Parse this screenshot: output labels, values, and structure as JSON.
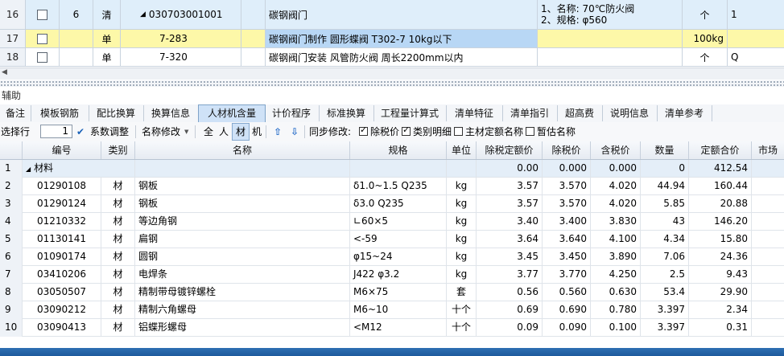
{
  "top_rows": [
    {
      "num": "16",
      "idx": "6",
      "type": "清",
      "code": "030703001001",
      "name": "碳钢阀门",
      "desc_line1": "1、名称: 70℃防火阀",
      "desc_line2": "2、规格: φ560",
      "unit": "个",
      "qty": "1"
    },
    {
      "num": "17",
      "idx": "",
      "type": "单",
      "code": "7-283",
      "name": "碳钢阀门制作 圆形蝶阀 T302-7 10kg以下",
      "desc_line1": "",
      "desc_line2": "",
      "unit": "100kg",
      "qty": ""
    },
    {
      "num": "18",
      "idx": "",
      "type": "单",
      "code": "7-320",
      "name": "碳钢阀门安装 风管防火阀 周长2200mm以内",
      "desc_line1": "",
      "desc_line2": "",
      "unit": "个",
      "qty": "Q"
    }
  ],
  "aux_label": "辅助",
  "tabs": [
    "备注",
    "模板钢筋",
    "配比换算",
    "换算信息",
    "人材机含量",
    "计价程序",
    "标准换算",
    "工程量计算式",
    "清单特征",
    "清单指引",
    "超高费",
    "说明信息",
    "清单参考"
  ],
  "active_tab": "人材机含量",
  "toolbar": {
    "select_row_label": "选择行",
    "select_row_value": "1",
    "coef_adjust_label": "系数调整",
    "name_modify_label": "名称修改",
    "filter_all": "全",
    "filter_person": "人",
    "filter_material": "材",
    "filter_machine": "机",
    "sync_label": "同步修改:",
    "chk_tax_excl": "除税价",
    "chk_category": "类别明细",
    "chk_main_quota": "主材定额名称",
    "chk_temp_name": "暂估名称"
  },
  "grid": {
    "headers": [
      "编号",
      "类别",
      "名称",
      "规格",
      "单位",
      "除税定额价",
      "除税价",
      "含税价",
      "数量",
      "定额合价",
      "市场"
    ],
    "group_row": {
      "num": "1",
      "label": "材料",
      "quota_price": "0.00",
      "tax_excl_price": "0.000",
      "tax_incl_price": "0.000",
      "qty": "0",
      "total": "412.54"
    },
    "rows": [
      {
        "num": "2",
        "code": "01290108",
        "cat": "材",
        "name": "钢板",
        "spec": "δ1.0~1.5 Q235",
        "unit": "kg",
        "quota_price": "3.57",
        "tax_excl": "3.570",
        "tax_incl": "4.020",
        "qty": "44.94",
        "total": "160.44"
      },
      {
        "num": "3",
        "code": "01290124",
        "cat": "材",
        "name": "钢板",
        "spec": "δ3.0 Q235",
        "unit": "kg",
        "quota_price": "3.57",
        "tax_excl": "3.570",
        "tax_incl": "4.020",
        "qty": "5.85",
        "total": "20.88"
      },
      {
        "num": "4",
        "code": "01210332",
        "cat": "材",
        "name": "等边角钢",
        "spec": "∟60×5",
        "unit": "kg",
        "quota_price": "3.40",
        "tax_excl": "3.400",
        "tax_incl": "3.830",
        "qty": "43",
        "total": "146.20"
      },
      {
        "num": "5",
        "code": "01130141",
        "cat": "材",
        "name": "扁钢",
        "spec": "<-59",
        "unit": "kg",
        "quota_price": "3.64",
        "tax_excl": "3.640",
        "tax_incl": "4.100",
        "qty": "4.34",
        "total": "15.80"
      },
      {
        "num": "6",
        "code": "01090174",
        "cat": "材",
        "name": "圆钢",
        "spec": "φ15~24",
        "unit": "kg",
        "quota_price": "3.45",
        "tax_excl": "3.450",
        "tax_incl": "3.890",
        "qty": "7.06",
        "total": "24.36"
      },
      {
        "num": "7",
        "code": "03410206",
        "cat": "材",
        "name": "电焊条",
        "spec": "J422 φ3.2",
        "unit": "kg",
        "quota_price": "3.77",
        "tax_excl": "3.770",
        "tax_incl": "4.250",
        "qty": "2.5",
        "total": "9.43"
      },
      {
        "num": "8",
        "code": "03050507",
        "cat": "材",
        "name": "精制带母镀锌螺栓",
        "spec": "M6×75",
        "unit": "套",
        "quota_price": "0.56",
        "tax_excl": "0.560",
        "tax_incl": "0.630",
        "qty": "53.4",
        "total": "29.90"
      },
      {
        "num": "9",
        "code": "03090212",
        "cat": "材",
        "name": "精制六角螺母",
        "spec": "M6~10",
        "unit": "十个",
        "quota_price": "0.69",
        "tax_excl": "0.690",
        "tax_incl": "0.780",
        "qty": "3.397",
        "total": "2.34"
      },
      {
        "num": "10",
        "code": "03090413",
        "cat": "材",
        "name": "铝蝶形螺母",
        "spec": "<M12",
        "unit": "十个",
        "quota_price": "0.09",
        "tax_excl": "0.090",
        "tax_incl": "0.100",
        "qty": "3.397",
        "total": "0.31"
      }
    ]
  },
  "colors": {
    "selected_row": "#fdf8a8",
    "top_bg": "#dfeefa",
    "highlight_cell": "#b8d7f5",
    "active_tab": "#cfe2f7",
    "status_bar": "#1d5a9d"
  }
}
